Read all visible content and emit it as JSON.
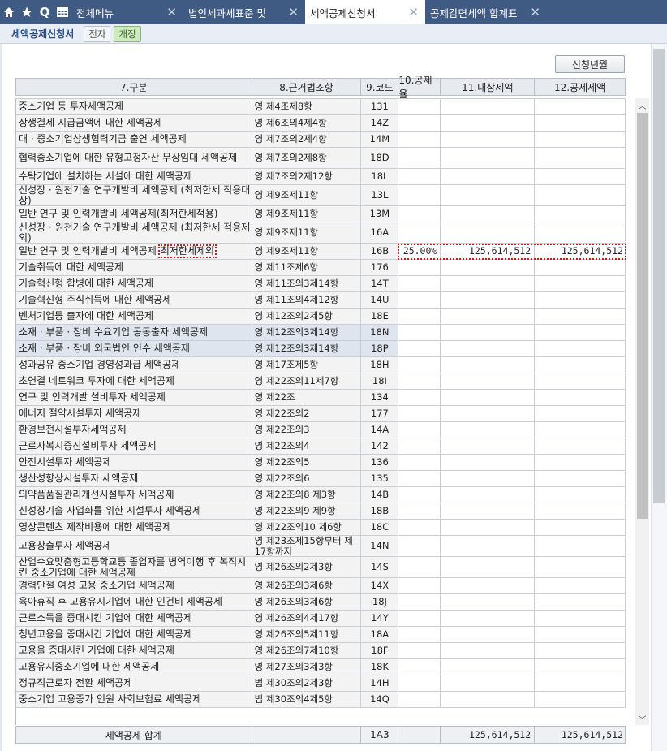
{
  "topbar": {
    "icons": [
      "home-icon",
      "star-icon",
      "search-icon",
      "grid-menu-icon"
    ],
    "search_glyph": "Q",
    "close_glyph": "✕",
    "tabs": [
      {
        "label": "전체메뉴",
        "closable": false,
        "active": false
      },
      {
        "label": "법인세과세표준 및",
        "closable": true,
        "active": false
      },
      {
        "label": "세액공제신청서",
        "closable": true,
        "active": true
      },
      {
        "label": "공제감면세액 합계표",
        "closable": true,
        "active": false
      }
    ]
  },
  "subhead": {
    "title": "세액공제신청서",
    "pill_prev": "전자",
    "pill_current": "개정"
  },
  "apply_button": "신청년월",
  "headers": [
    "7.구분",
    "8.근거법조항",
    "9.코드",
    "10.공제율",
    "11.대상세액",
    "12.공제세액"
  ],
  "rows": [
    {
      "name": "중소기업 등 투자세액공제",
      "law": "영 제4조제8항",
      "code": "131",
      "rate": "",
      "target": "",
      "credit": ""
    },
    {
      "name": "상생결제 지급금액에 대한 세액공제",
      "law": "영 제6조의4제4항",
      "code": "14Z",
      "rate": "",
      "target": "",
      "credit": ""
    },
    {
      "name": "대 · 중소기업상생협력기금 출연 세액공제",
      "law": "영 제7조의2제4항",
      "code": "14M",
      "rate": "",
      "target": "",
      "credit": ""
    },
    {
      "name": "협력중소기업에 대한 유형고정자산 무상임대 세액공제",
      "law": "영 제7조의2제8항",
      "code": "18D",
      "rate": "",
      "target": "",
      "credit": ""
    },
    {
      "name": "수탁기업에 설치하는 시설에 대한 세액공제",
      "law": "영 제7조의2제12항",
      "code": "18L",
      "rate": "",
      "target": "",
      "credit": ""
    },
    {
      "name": "신성장 · 원천기술 연구개발비 세액공제 (최저한세 적용대상)",
      "law": "영 제9조제11항",
      "code": "13L",
      "rate": "",
      "target": "",
      "credit": ""
    },
    {
      "name": "일반 연구 및 인력개발비 세액공제(최저한세적용)",
      "law": "영 제9조제11항",
      "code": "13M",
      "rate": "",
      "target": "",
      "credit": ""
    },
    {
      "name": "신성장 · 원천기술 연구개발비 세액공제 (최저한세 적용제외)",
      "law": "영 제9조제11항",
      "code": "16A",
      "rate": "",
      "target": "",
      "credit": ""
    },
    {
      "name": "일반 연구 및 인력개발비 세액공제",
      "name_suffix": "최저한세제외",
      "law": "영 제9조제11항",
      "code": "16B",
      "rate": "25.00%",
      "target": "125,614,512",
      "credit": "125,614,512"
    },
    {
      "name": "기술취득에 대한 세액공제",
      "law": "영 제11조제6항",
      "code": "176",
      "rate": "",
      "target": "",
      "credit": ""
    },
    {
      "name": "기술혁신형 합병에 대한 세액공제",
      "law": "영 제11조의3제14항",
      "code": "14T",
      "rate": "",
      "target": "",
      "credit": ""
    },
    {
      "name": "기술혁신형 주식취득에 대한 세액공제",
      "law": "영 제11조의4제12항",
      "code": "14U",
      "rate": "",
      "target": "",
      "credit": ""
    },
    {
      "name": "벤처기업등 출자에 대한 세액공제",
      "law": "영 제12조의2제5항",
      "code": "18E",
      "rate": "",
      "target": "",
      "credit": ""
    },
    {
      "name": "소재 · 부품 · 장비 수요기업 공동출자 세액공제",
      "law": "영 제12조의3제14항",
      "code": "18N",
      "rate": "",
      "target": "",
      "credit": ""
    },
    {
      "name": "소재 · 부품 · 장비 외국법인 인수 세액공제",
      "law": "영 제12조의3제14항",
      "code": "18P",
      "rate": "",
      "target": "",
      "credit": ""
    },
    {
      "name": "성과공유 중소기업 경영성과급 세액공제",
      "law": "영 제17조제5항",
      "code": "18H",
      "rate": "",
      "target": "",
      "credit": ""
    },
    {
      "name": "초연결 네트워크 투자에 대한 세액공제",
      "law": "영 제22조의11제7항",
      "code": "18I",
      "rate": "",
      "target": "",
      "credit": ""
    },
    {
      "name": "연구 및 인력개발 설비투자 세액공제",
      "law": "영 제22조",
      "code": "134",
      "rate": "",
      "target": "",
      "credit": ""
    },
    {
      "name": "에너지 절약시설투자 세액공제",
      "law": "영 제22조의2",
      "code": "177",
      "rate": "",
      "target": "",
      "credit": ""
    },
    {
      "name": "환경보전시설투자세액공제",
      "law": "영 제22조의3",
      "code": "14A",
      "rate": "",
      "target": "",
      "credit": ""
    },
    {
      "name": "근로자복지증진설비투자 세액공제",
      "law": "영 제22조의4",
      "code": "142",
      "rate": "",
      "target": "",
      "credit": ""
    },
    {
      "name": "안전시설투자 세액공제",
      "law": "영 제22조의5",
      "code": "136",
      "rate": "",
      "target": "",
      "credit": ""
    },
    {
      "name": "생산성향상시설투자 세액공제",
      "law": "영 제22조의6",
      "code": "135",
      "rate": "",
      "target": "",
      "credit": ""
    },
    {
      "name": "의약품품질관리개선시설투자 세액공제",
      "law": "영 제22조의8 제3항",
      "code": "14B",
      "rate": "",
      "target": "",
      "credit": ""
    },
    {
      "name": "신성장기술 사업화를 위한 시설투자 세액공제",
      "law": "영 제22조의9 제9항",
      "code": "18B",
      "rate": "",
      "target": "",
      "credit": ""
    },
    {
      "name": "영상콘텐츠 제작비용에 대한 세액공제",
      "law": "영 제22조의10 제6항",
      "code": "18C",
      "rate": "",
      "target": "",
      "credit": ""
    },
    {
      "name": "고용창출투자 세액공제",
      "law": "영 제23조제15항부터 제17항까지",
      "code": "14N",
      "rate": "",
      "target": "",
      "credit": ""
    },
    {
      "name": "산업수요맞춤형고등학교등 졸업자를 병역이행 후 복직시킨 중소기업에 대한 세액공제",
      "law": "영 제26조의2제3항",
      "code": "14S",
      "rate": "",
      "target": "",
      "credit": ""
    },
    {
      "name": "경력단절 여성 고용 중소기업 세액공제",
      "law": "영 제26조의3제6항",
      "code": "14X",
      "rate": "",
      "target": "",
      "credit": ""
    },
    {
      "name": "육아휴직 후 고용유지기업에 대한 인건비 세액공제",
      "law": "영 제26조의3제6항",
      "code": "18J",
      "rate": "",
      "target": "",
      "credit": ""
    },
    {
      "name": "근로소득을 증대시킨 기업에 대한 세액공제",
      "law": "영 제26조의4제17항",
      "code": "14Y",
      "rate": "",
      "target": "",
      "credit": ""
    },
    {
      "name": "청년고용을 증대시킨 기업에 대한 세액공제",
      "law": "영 제26조의5제11항",
      "code": "18A",
      "rate": "",
      "target": "",
      "credit": ""
    },
    {
      "name": "고용을 증대시킨 기업에 대한 세액공제",
      "law": "영 제26조의7제10항",
      "code": "18F",
      "rate": "",
      "target": "",
      "credit": ""
    },
    {
      "name": "고용유지중소기업에 대한 세액공제",
      "law": "영 제27조의3제3항",
      "code": "18K",
      "rate": "",
      "target": "",
      "credit": ""
    },
    {
      "name": "정규직근로자 전환 세액공제",
      "law": "법 제30조의2제3항",
      "code": "14H",
      "rate": "",
      "target": "",
      "credit": ""
    },
    {
      "name": "중소기업 고용증가 인원 사회보험료 세액공제",
      "law": "법 제30조의4제5항",
      "code": "14Q",
      "rate": "",
      "target": "",
      "credit": ""
    }
  ],
  "footer": {
    "label": "세액공제 합계",
    "code": "1A3",
    "rate": "",
    "target": "125,614,512",
    "credit": "125,614,512"
  },
  "scroll": {
    "up": "︿",
    "down": "﹀"
  }
}
